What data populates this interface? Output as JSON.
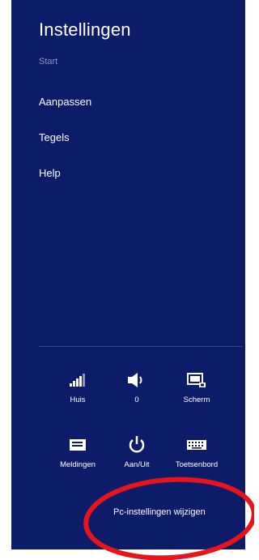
{
  "panel": {
    "title": "Instellingen",
    "menu": [
      {
        "label": "Start",
        "dim": true
      },
      {
        "label": "Aanpassen"
      },
      {
        "label": "Tegels"
      },
      {
        "label": "Help"
      }
    ]
  },
  "tiles": {
    "network": {
      "label": "Huis",
      "icon": "network-signal-icon"
    },
    "volume": {
      "label": "0",
      "icon": "speaker-icon"
    },
    "screen": {
      "label": "Scherm",
      "icon": "screen-brightness-icon"
    },
    "notifications": {
      "label": "Meldingen",
      "icon": "notifications-icon"
    },
    "power": {
      "label": "Aan/Uit",
      "icon": "power-icon"
    },
    "keyboard": {
      "label": "Toetsenbord",
      "icon": "keyboard-icon"
    }
  },
  "footer": {
    "change_pc_settings": "Pc-instellingen wijzigen"
  },
  "colors": {
    "panel_background": "#0d1c69",
    "annotation_ellipse": "#e8141b"
  }
}
